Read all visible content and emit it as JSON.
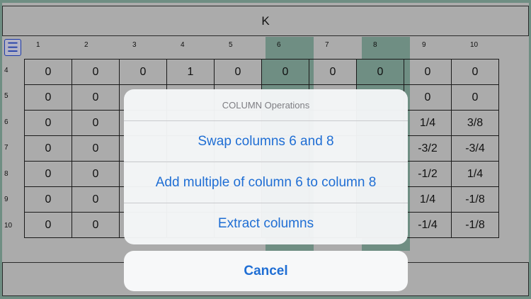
{
  "header": {
    "title": "K"
  },
  "menu_icon": "menu-icon",
  "column_headers": [
    "1",
    "2",
    "3",
    "4",
    "5",
    "6",
    "7",
    "8",
    "9",
    "10"
  ],
  "row_headers": [
    "4",
    "5",
    "6",
    "7",
    "8",
    "9",
    "10"
  ],
  "highlighted_columns": [
    6,
    8
  ],
  "matrix": {
    "rows": [
      [
        "0",
        "0",
        "0",
        "1",
        "0",
        "0",
        "0",
        "0",
        "0",
        "0"
      ],
      [
        "0",
        "0",
        "",
        "",
        "",
        "",
        "",
        "",
        "0",
        "0"
      ],
      [
        "0",
        "0",
        "",
        "",
        "",
        "",
        "",
        "",
        "1/4",
        "3/8"
      ],
      [
        "0",
        "0",
        "",
        "",
        "",
        "",
        "",
        "",
        "-3/2",
        "-3/4"
      ],
      [
        "0",
        "0",
        "",
        "",
        "",
        "",
        "",
        "",
        "-1/2",
        "1/4"
      ],
      [
        "0",
        "0",
        "",
        "",
        "",
        "",
        "",
        "",
        "1/4",
        "-1/8"
      ],
      [
        "0",
        "0",
        "",
        "",
        "",
        "",
        "",
        "",
        "-1/4",
        "-1/8"
      ]
    ]
  },
  "action_sheet": {
    "title": "COLUMN Operations",
    "actions": [
      {
        "label": "Swap columns 6 and 8"
      },
      {
        "label": "Add multiple of column 6 to column 8"
      },
      {
        "label": "Extract columns"
      }
    ],
    "cancel_label": "Cancel"
  },
  "colors": {
    "background": "#6f8e83",
    "panel": "#ababab",
    "accent": "#1f6ed4"
  }
}
